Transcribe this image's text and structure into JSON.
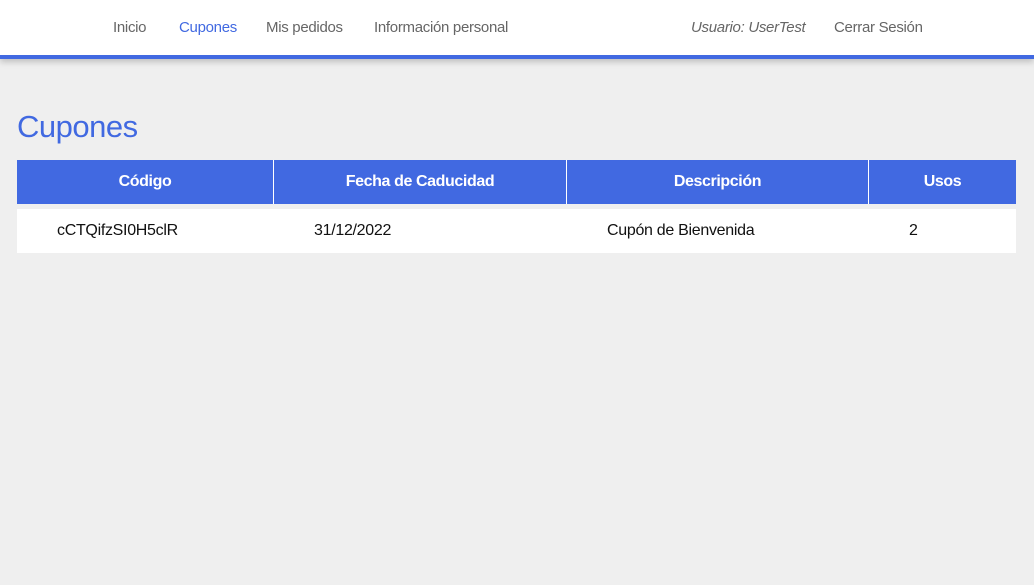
{
  "nav": {
    "items": [
      {
        "label": "Inicio",
        "active": false
      },
      {
        "label": "Cupones",
        "active": true
      },
      {
        "label": "Mis pedidos",
        "active": false
      },
      {
        "label": "Información personal",
        "active": false
      }
    ],
    "user": "Usuario: UserTest",
    "logout": "Cerrar Sesión"
  },
  "page": {
    "title": "Cupones"
  },
  "table": {
    "headers": [
      "Código",
      "Fecha de Caducidad",
      "Descripción",
      "Usos"
    ],
    "rows": [
      [
        "cCTQifzSI0H5clR",
        "31/12/2022",
        "Cupón de Bienvenida",
        "2"
      ]
    ]
  },
  "colors": {
    "accent": "#4169e1",
    "background": "#efefef"
  }
}
